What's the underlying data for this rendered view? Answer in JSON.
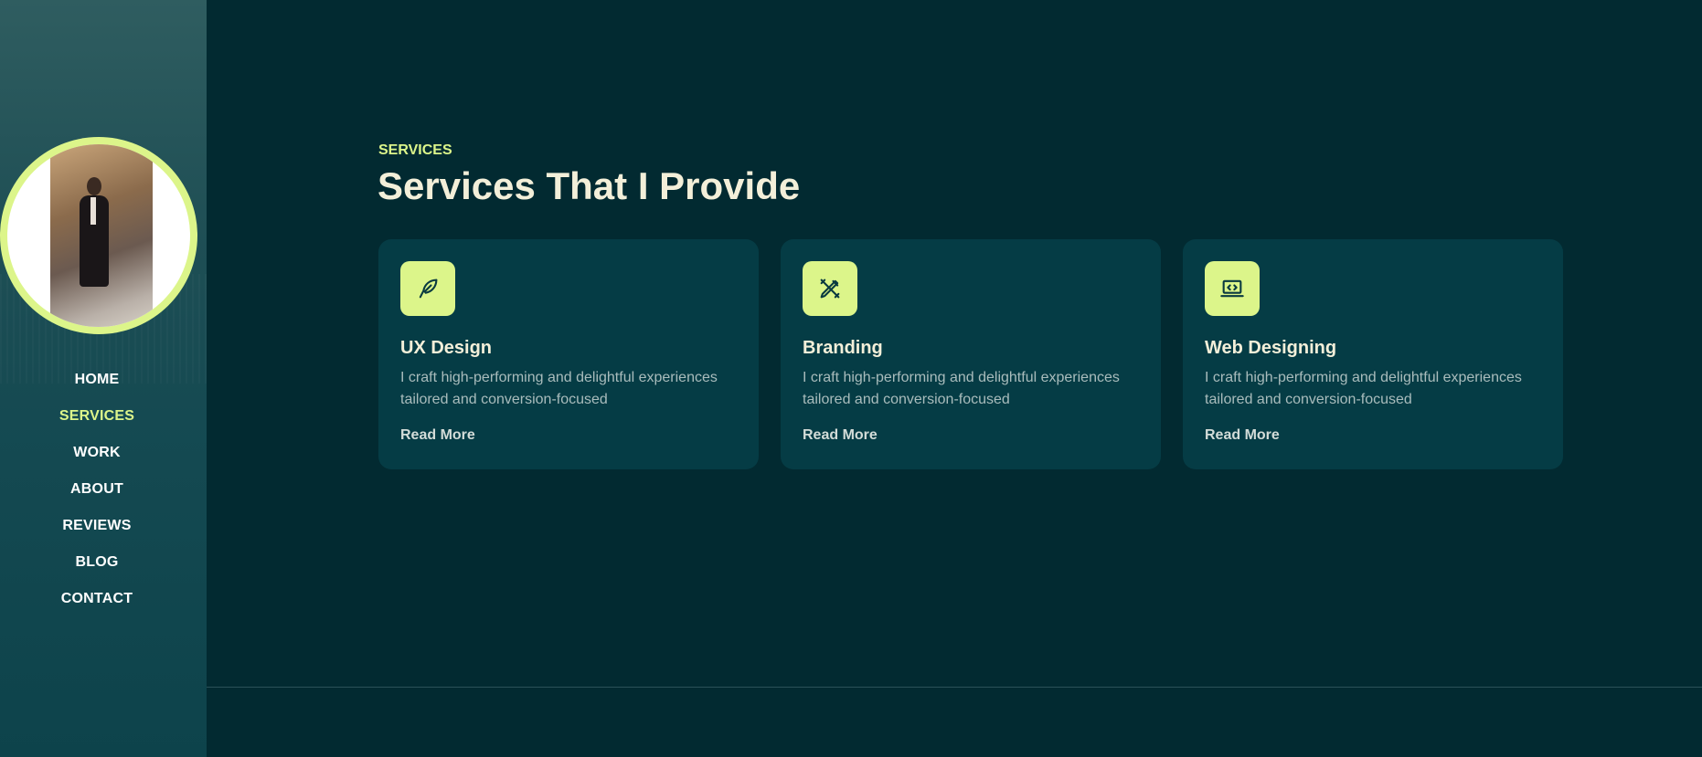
{
  "sidebar": {
    "nav": [
      {
        "label": "HOME"
      },
      {
        "label": "SERVICES"
      },
      {
        "label": "WORK"
      },
      {
        "label": "ABOUT"
      },
      {
        "label": "REVIEWS"
      },
      {
        "label": "BLOG"
      },
      {
        "label": "CONTACT"
      }
    ],
    "active_item": "SERVICES"
  },
  "section": {
    "eyebrow": "SERVICES",
    "title": "Services That I Provide"
  },
  "cards": [
    {
      "icon": "feather-icon",
      "title": "UX Design",
      "description": "I craft high-performing and delightful experiences tailored and conversion-focused",
      "link": "Read More"
    },
    {
      "icon": "pen-ruler-icon",
      "title": "Branding",
      "description": "I craft high-performing and delightful experiences tailored and conversion-focused",
      "link": "Read More"
    },
    {
      "icon": "laptop-code-icon",
      "title": "Web Designing",
      "description": "I craft high-performing and delightful experiences tailored and conversion-focused",
      "link": "Read More"
    }
  ],
  "colors": {
    "background": "#022a31",
    "card": "#053c45",
    "accent": "#dcf58a",
    "heading": "#f3efd9",
    "body_text": "#a9bcbc"
  }
}
